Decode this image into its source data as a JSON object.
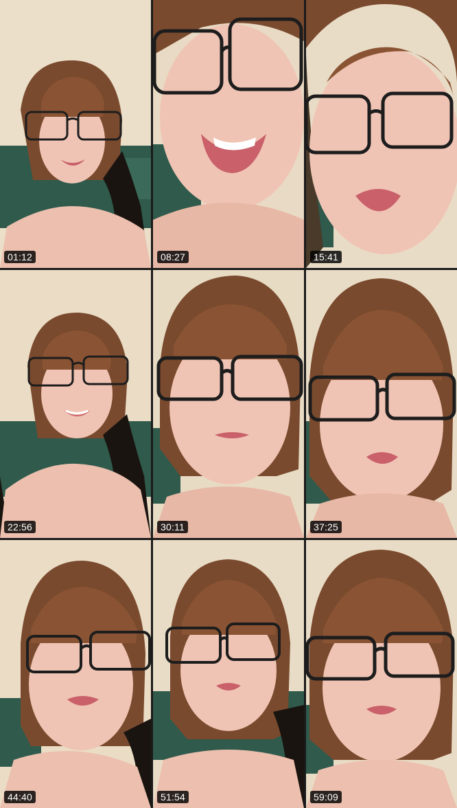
{
  "tiles": [
    {
      "timestamp": "01:12",
      "glasses": "black",
      "scene": "wide"
    },
    {
      "timestamp": "08:27",
      "glasses": "black",
      "scene": "close-up"
    },
    {
      "timestamp": "15:41",
      "glasses": "black",
      "scene": "close-up"
    },
    {
      "timestamp": "22:56",
      "glasses": "black",
      "scene": "wide"
    },
    {
      "timestamp": "30:11",
      "glasses": "black",
      "scene": "close-up"
    },
    {
      "timestamp": "37:25",
      "glasses": "black",
      "scene": "close-up"
    },
    {
      "timestamp": "44:40",
      "glasses": "black",
      "scene": "medium"
    },
    {
      "timestamp": "51:54",
      "glasses": "black",
      "scene": "medium"
    },
    {
      "timestamp": "59:09",
      "glasses": "black",
      "scene": "medium"
    }
  ],
  "colors": {
    "wall": "#e9dcc6",
    "curtain": "#2f5a4c",
    "hair": "#7a4a2e",
    "skin": "#f0c4b4",
    "lips": "#c9606a",
    "glasses": "#1d1d1d",
    "badge_bg": "#000000",
    "badge_text": "#ffffff"
  }
}
